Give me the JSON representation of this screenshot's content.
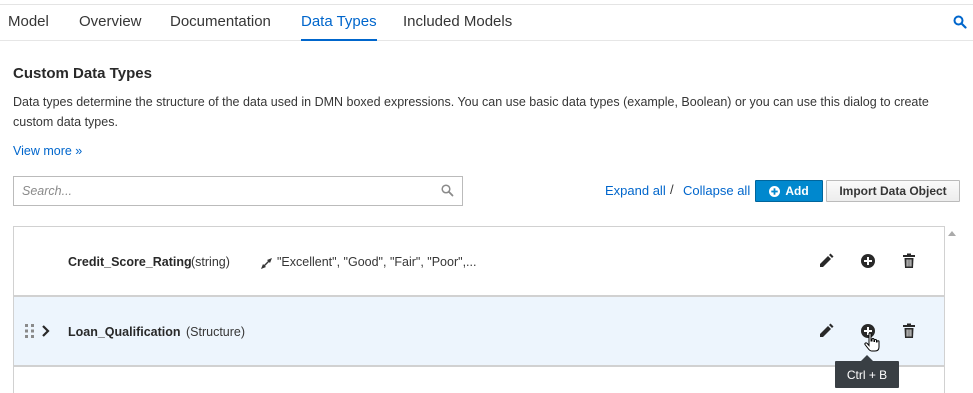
{
  "tabs": [
    {
      "label": "Model",
      "active": false
    },
    {
      "label": "Overview",
      "active": false
    },
    {
      "label": "Documentation",
      "active": false
    },
    {
      "label": "Data Types",
      "active": true
    },
    {
      "label": "Included Models",
      "active": false
    }
  ],
  "header_search_icon": "search-icon",
  "section": {
    "title": "Custom Data Types",
    "description": "Data types determine the structure of the data used in DMN boxed expressions. You can use basic data types (example, Boolean) or you can use this dialog to create custom data types.",
    "view_more": "View more »"
  },
  "search": {
    "placeholder": "Search...",
    "value": ""
  },
  "toolbar": {
    "expand_all": "Expand all",
    "separator": "/",
    "collapse_all": "Collapse all",
    "add_label": "Add",
    "import_label": "Import Data Object"
  },
  "data_types": [
    {
      "name": "Credit_Score_Rating",
      "type": "(string)",
      "constraint": "\"Excellent\", \"Good\", \"Fair\", \"Poor\",...",
      "expandable": false,
      "highlighted": false
    },
    {
      "name": "Loan_Qualification",
      "type": "(Structure)",
      "constraint": "",
      "expandable": true,
      "highlighted": true
    }
  ],
  "tooltip": "Ctrl + B",
  "colors": {
    "accent": "#0066cc",
    "primary_button": "#0088ce",
    "row_highlight": "#edf5fd",
    "tooltip_bg": "#393f44"
  }
}
